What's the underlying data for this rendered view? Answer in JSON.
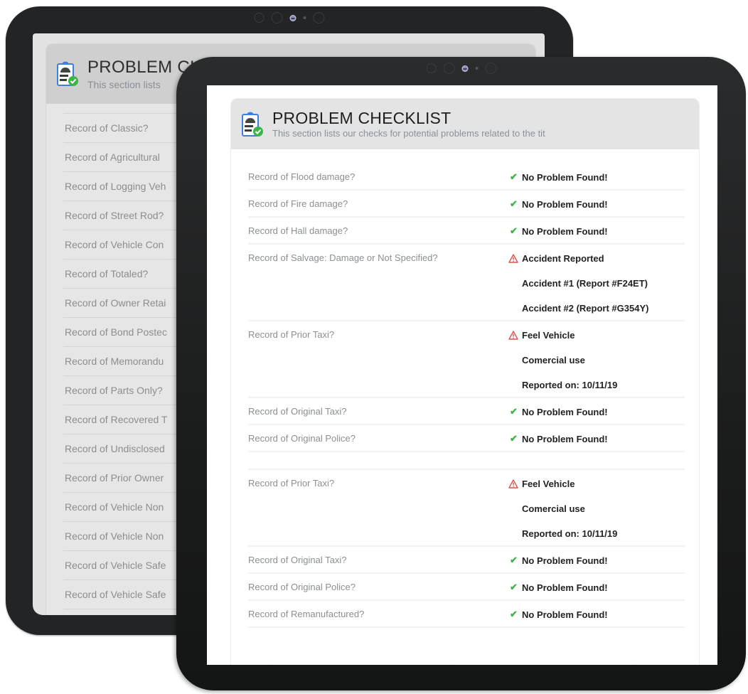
{
  "colors": {
    "ok": "#3bb54a",
    "warning": "#d9534f",
    "icon_blue": "#3d7fe0",
    "header_bg": "#e4e4e4"
  },
  "back_tablet": {
    "header": {
      "title": "PROBLEM CH",
      "subtitle": "This section lists"
    },
    "rows": [
      "Record of Classic?",
      "Record of Agricultural",
      "Record of Logging Veh",
      "Record of Street Rod?",
      "Record of Vehicle Con",
      "Record of Totaled?",
      "Record of Owner Retai",
      "Record of Bond Postec",
      "Record of Memorandu",
      "Record of Parts Only?",
      "Record of Recovered T",
      "Record of Undisclosed",
      "Record of Prior Owner",
      "Record of Vehicle Non",
      "Record of Vehicle Non",
      "Record of Vehicle Safe",
      "Record of Vehicle Safe"
    ]
  },
  "front_tablet": {
    "header": {
      "icon": "clipboard-car-check-icon",
      "title": "PROBLEM CHECKLIST",
      "subtitle": "This section lists our checks for potential problems related to the tit"
    },
    "rows": [
      {
        "label": "Record of Flood damage?",
        "status": "ok",
        "result": "No Problem Found!",
        "details": []
      },
      {
        "label": "Record of Fire damage?",
        "status": "ok",
        "result": "No Problem Found!",
        "details": []
      },
      {
        "label": "Record of Hall damage?",
        "status": "ok",
        "result": "No Problem Found!",
        "details": []
      },
      {
        "label": "Record of Salvage: Damage or Not Specified?",
        "status": "warning",
        "result": "Accident Reported",
        "details": [
          "Accident #1 (Report #F24ET)",
          "Accident #2 (Report #G354Y)"
        ]
      },
      {
        "label": "Record of Prior Taxi?",
        "status": "warning",
        "result": "Feel Vehicle",
        "details": [
          "Comercial use",
          "Reported on: 10/11/19"
        ]
      },
      {
        "label": "Record of Original Taxi?",
        "status": "ok",
        "result": "No Problem Found!",
        "details": []
      },
      {
        "label": "Record of Original Police?",
        "status": "ok",
        "result": "No Problem Found!",
        "details": []
      },
      {
        "label": "",
        "status": "spacer",
        "result": "",
        "details": []
      },
      {
        "label": "Record of Prior Taxi?",
        "status": "warning",
        "result": "Feel Vehicle",
        "details": [
          "Comercial use",
          "Reported on: 10/11/19"
        ]
      },
      {
        "label": "Record of Original Taxi?",
        "status": "ok",
        "result": "No Problem Found!",
        "details": []
      },
      {
        "label": "Record of Original Police?",
        "status": "ok",
        "result": "No Problem Found!",
        "details": []
      },
      {
        "label": "Record of Remanufactured?",
        "status": "ok",
        "result": "No Problem Found!",
        "details": []
      }
    ]
  }
}
